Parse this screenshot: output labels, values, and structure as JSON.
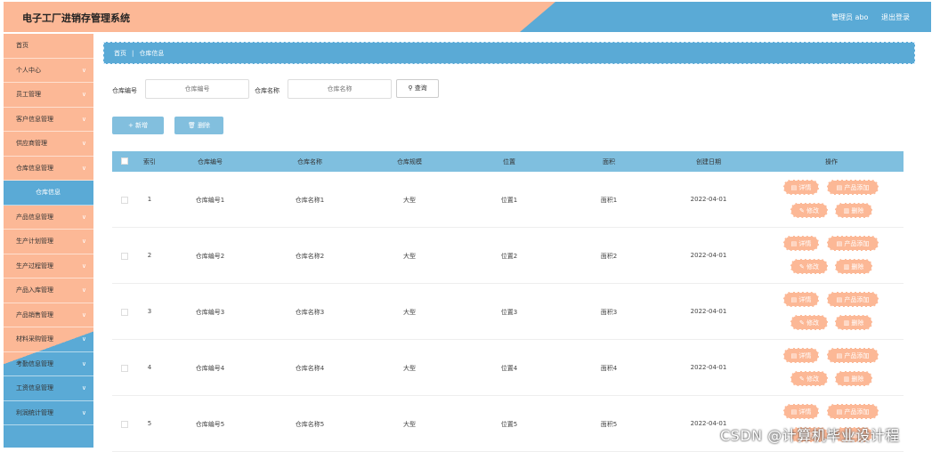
{
  "app": {
    "title": "电子工厂进销存管理系统",
    "user": "管理员 abo",
    "logout": "退出登录"
  },
  "sidebar": {
    "items": [
      {
        "label": "首页"
      },
      {
        "label": "个人中心",
        "chevron": true
      },
      {
        "label": "员工管理",
        "chevron": true
      },
      {
        "label": "客户信息管理",
        "chevron": true
      },
      {
        "label": "供应商管理",
        "chevron": true
      },
      {
        "label": "仓库信息管理",
        "chevron": true
      },
      {
        "label": "仓库信息",
        "sub": true
      },
      {
        "label": "产品信息管理",
        "chevron": true
      },
      {
        "label": "生产计划管理",
        "chevron": true
      },
      {
        "label": "生产过程管理",
        "chevron": true
      },
      {
        "label": "产品入库管理",
        "chevron": true
      },
      {
        "label": "产品销售管理",
        "chevron": true
      },
      {
        "label": "材料采购管理",
        "chevron": true
      },
      {
        "label": "考勤信息管理",
        "chevron": true
      },
      {
        "label": "工资信息管理",
        "chevron": true
      },
      {
        "label": "利润统计管理",
        "chevron": true
      }
    ]
  },
  "breadcrumb": {
    "home": "首页",
    "separator": "|",
    "current": "仓库信息"
  },
  "search": {
    "field1_label": "仓库编号",
    "field1_placeholder": "仓库编号",
    "field2_label": "仓库名称",
    "field2_placeholder": "仓库名称",
    "query_label": "查询"
  },
  "actions": {
    "add_label": "+ 新增",
    "delete_label": "删除"
  },
  "table": {
    "columns": [
      "索引",
      "仓库编号",
      "仓库名称",
      "仓库规模",
      "位置",
      "面积",
      "创建日期",
      "操作"
    ],
    "rows": [
      {
        "index": "1",
        "code": "仓库编号1",
        "name": "仓库名称1",
        "scale": "大型",
        "location": "位置1",
        "area": "面积1",
        "date": "2022-04-01"
      },
      {
        "index": "2",
        "code": "仓库编号2",
        "name": "仓库名称2",
        "scale": "大型",
        "location": "位置2",
        "area": "面积2",
        "date": "2022-04-01"
      },
      {
        "index": "3",
        "code": "仓库编号3",
        "name": "仓库名称3",
        "scale": "大型",
        "location": "位置3",
        "area": "面积3",
        "date": "2022-04-01"
      },
      {
        "index": "4",
        "code": "仓库编号4",
        "name": "仓库名称4",
        "scale": "大型",
        "location": "位置4",
        "area": "面积4",
        "date": "2022-04-01"
      },
      {
        "index": "5",
        "code": "仓库编号5",
        "name": "仓库名称5",
        "scale": "大型",
        "location": "位置5",
        "area": "面积5",
        "date": "2022-04-01"
      }
    ],
    "row_ops": {
      "detail": "详情",
      "add_product": "产品添加",
      "edit": "修改",
      "delete": "删除"
    }
  },
  "watermark": "CSDN @计算机毕业设计程",
  "colors": {
    "accent_orange": "#fcb896",
    "accent_blue": "#5aaad6"
  }
}
